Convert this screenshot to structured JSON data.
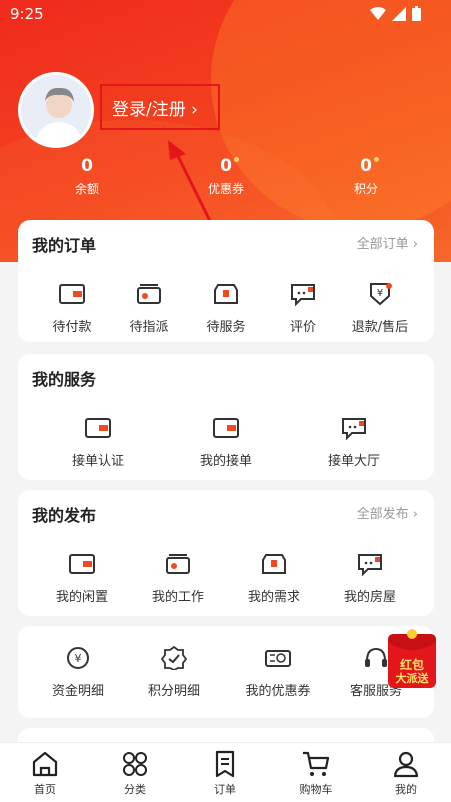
{
  "status": {
    "time": "9:25"
  },
  "profile": {
    "login_label": "登录/注册 ›"
  },
  "stats": [
    {
      "value": "0",
      "label": "余额"
    },
    {
      "value": "0",
      "label": "优惠券"
    },
    {
      "value": "0",
      "label": "积分"
    }
  ],
  "orders": {
    "title": "我的订单",
    "more": "全部订单 ›",
    "items": [
      "待付款",
      "待指派",
      "待服务",
      "评价",
      "退款/售后"
    ]
  },
  "services": {
    "title": "我的服务",
    "items": [
      "接单认证",
      "我的接单",
      "接单大厅"
    ]
  },
  "publish": {
    "title": "我的发布",
    "more": "全部发布 ›",
    "items": [
      "我的闲置",
      "我的工作",
      "我的需求",
      "我的房屋"
    ]
  },
  "tools": {
    "items": [
      "资金明细",
      "积分明细",
      "我的优惠券",
      "客服服务"
    ]
  },
  "promo": {
    "line1": "红包",
    "line2": "大派送"
  },
  "tabs": [
    "首页",
    "分类",
    "订单",
    "购物车",
    "我的"
  ],
  "colors": {
    "accent": "#f04a23",
    "annotation": "#e3161b"
  }
}
